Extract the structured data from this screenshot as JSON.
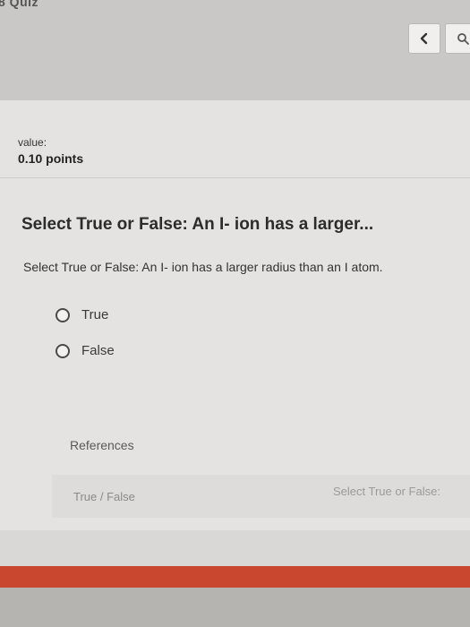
{
  "header": {
    "quiz_label": "8 Quiz",
    "prev_icon": "chevron-left-icon",
    "search_icon": "search-icon"
  },
  "score": {
    "value_label": "value:",
    "points": "0.10 points"
  },
  "question": {
    "title": "Select True or False: An I- ion has a larger...",
    "text": "Select True or False: An I- ion has a larger radius than an I atom.",
    "options": [
      {
        "label": "True"
      },
      {
        "label": "False"
      }
    ]
  },
  "references": {
    "heading": "References",
    "type": "True / False",
    "title": "Select True or False:"
  },
  "colors": {
    "accent_bar": "#c9462f"
  }
}
